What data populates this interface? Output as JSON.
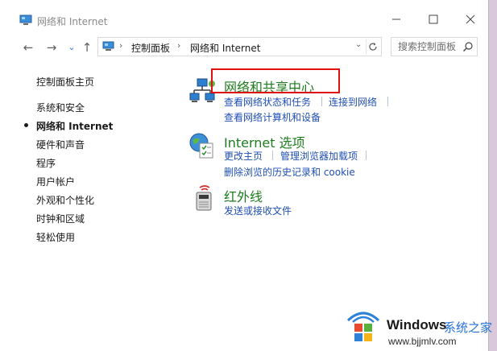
{
  "window": {
    "title": "网络和 Internet",
    "icons": {
      "app": "control-panel-icon",
      "minimize": "minimize-icon",
      "maximize": "maximize-icon",
      "close": "close-icon"
    }
  },
  "nav": {
    "back": "←",
    "forward": "→",
    "recent": "⌄",
    "up": "↑"
  },
  "address": {
    "crumbs": [
      "控制面板",
      "网络和 Internet"
    ],
    "separator": "›"
  },
  "search": {
    "placeholder": "搜索控制面板"
  },
  "sidebar": {
    "items": [
      {
        "label": "控制面板主页",
        "active": false
      },
      {
        "label": "系统和安全",
        "active": false
      },
      {
        "label": "网络和 Internet",
        "active": true
      },
      {
        "label": "硬件和声音",
        "active": false
      },
      {
        "label": "程序",
        "active": false
      },
      {
        "label": "用户帐户",
        "active": false
      },
      {
        "label": "外观和个性化",
        "active": false
      },
      {
        "label": "时钟和区域",
        "active": false
      },
      {
        "label": "轻松使用",
        "active": false
      }
    ]
  },
  "categories": [
    {
      "icon": "network-sharing-center-icon",
      "title": "网络和共享中心",
      "links": [
        "查看网络状态和任务",
        "连接到网络",
        "查看网络计算机和设备"
      ]
    },
    {
      "icon": "internet-options-icon",
      "title": "Internet 选项",
      "links": [
        "更改主页",
        "管理浏览器加载项",
        "删除浏览的历史记录和 cookie"
      ]
    },
    {
      "icon": "infrared-icon",
      "title": "红外线",
      "links": [
        "发送或接收文件"
      ]
    }
  ],
  "watermark": {
    "brand": "Windows",
    "brand_cn": "系统之家",
    "url": "www.bjjmlv.com"
  },
  "colors": {
    "category_title": "#1e7b1e",
    "link": "#1f4fb3",
    "highlight": "#e01010"
  }
}
